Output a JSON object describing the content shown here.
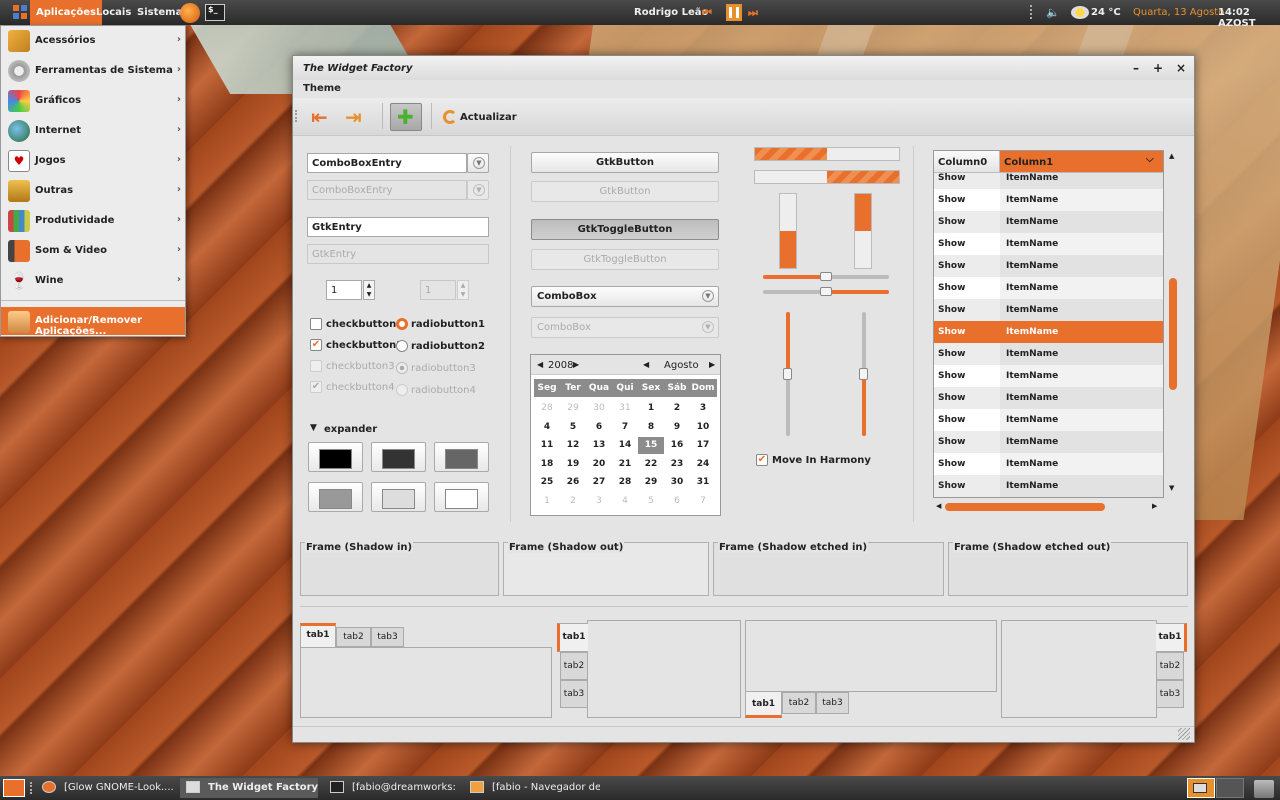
{
  "top_panel": {
    "menus": [
      "Aplicações",
      "Locais",
      "Sistema"
    ],
    "now_playing": "Rodrigo Leão",
    "weather": "24 °C",
    "date": "Quarta, 13 Agosto",
    "time": "14:02 AZOST"
  },
  "app_menu": {
    "items": [
      {
        "label": "Acessórios",
        "icon": "accessories-icon"
      },
      {
        "label": "Ferramentas de Sistema",
        "icon": "system-tools-icon"
      },
      {
        "label": "Gráficos",
        "icon": "graphics-icon"
      },
      {
        "label": "Internet",
        "icon": "internet-icon"
      },
      {
        "label": "Jogos",
        "icon": "games-icon"
      },
      {
        "label": "Outras",
        "icon": "other-icon"
      },
      {
        "label": "Produtividade",
        "icon": "office-icon"
      },
      {
        "label": "Som & Video",
        "icon": "sound-video-icon"
      },
      {
        "label": "Wine",
        "icon": "wine-icon"
      }
    ],
    "add_remove": "Adicionar/Remover Aplicações..."
  },
  "window": {
    "title": "The Widget Factory",
    "menu": "Theme",
    "toolbar_refresh": "Actualizar"
  },
  "col1": {
    "combo_entry": "ComboBoxEntry",
    "combo_entry_dis": "ComboBoxEntry",
    "entry": "GtkEntry",
    "entry_dis": "GtkEntry",
    "spin": "1",
    "spin_dis": "1",
    "checks": [
      "checkbutton1",
      "checkbutton2",
      "checkbutton3",
      "checkbutton4"
    ],
    "radios": [
      "radiobutton1",
      "radiobutton2",
      "radiobutton3",
      "radiobutton4"
    ],
    "expander": "expander"
  },
  "col2": {
    "button": "GtkButton",
    "button_dis": "GtkButton",
    "toggle": "GtkToggleButton",
    "toggle_dis": "GtkToggleButton",
    "combo": "ComboBox",
    "combo_dis": "ComboBox",
    "cal_year": "2008",
    "cal_month": "Agosto",
    "cal_days": [
      "Seg",
      "Ter",
      "Qua",
      "Qui",
      "Sex",
      "Sáb",
      "Dom"
    ],
    "cal_weeks": [
      [
        "28",
        "29",
        "30",
        "31",
        "1",
        "2",
        "3"
      ],
      [
        "4",
        "5",
        "6",
        "7",
        "8",
        "9",
        "10"
      ],
      [
        "11",
        "12",
        "13",
        "14",
        "15",
        "16",
        "17"
      ],
      [
        "18",
        "19",
        "20",
        "21",
        "22",
        "23",
        "24"
      ],
      [
        "25",
        "26",
        "27",
        "28",
        "29",
        "30",
        "31"
      ],
      [
        "1",
        "2",
        "3",
        "4",
        "5",
        "6",
        "7"
      ]
    ],
    "cal_selected": "15"
  },
  "col3": {
    "harmony": "Move In Harmony",
    "progress_h": [
      0.5,
      0.5
    ],
    "progress_v": [
      0.5,
      0.5
    ],
    "scale_h": [
      0.5,
      0.5
    ]
  },
  "tree": {
    "col0": "Column0",
    "col1": "Column1",
    "rows": [
      [
        "Show",
        "ItemName"
      ],
      [
        "Show",
        "ItemName"
      ],
      [
        "Show",
        "ItemName"
      ],
      [
        "Show",
        "ItemName"
      ],
      [
        "Show",
        "ItemName"
      ],
      [
        "Show",
        "ItemName"
      ],
      [
        "Show",
        "ItemName"
      ],
      [
        "Show",
        "ItemName"
      ],
      [
        "Show",
        "ItemName"
      ],
      [
        "Show",
        "ItemName"
      ],
      [
        "Show",
        "ItemName"
      ],
      [
        "Show",
        "ItemName"
      ],
      [
        "Show",
        "ItemName"
      ],
      [
        "Show",
        "ItemName"
      ],
      [
        "Show",
        "ItemName"
      ]
    ],
    "selected_row": 7
  },
  "frames": [
    "Frame (Shadow in)",
    "Frame (Shadow out)",
    "Frame (Shadow etched in)",
    "Frame (Shadow etched out)"
  ],
  "tabs": [
    "tab1",
    "tab2",
    "tab3"
  ],
  "taskbar": {
    "tasks": [
      "[Glow GNOME-Look....",
      "The Widget Factory",
      "[fabio@dreamworks: ...",
      "[fabio - Navegador de ..."
    ]
  }
}
